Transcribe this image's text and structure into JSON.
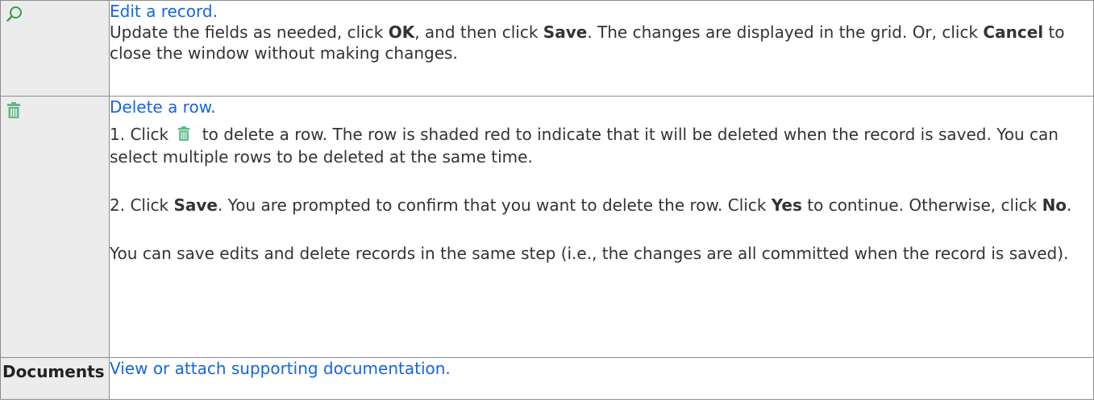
{
  "rows": [
    {
      "icon": "magnifier-icon",
      "link": "Edit a record.",
      "text": [
        "Update the fields as needed, click ",
        "OK",
        ", and then click ",
        "Save",
        ". The changes are displayed in the grid. Or, click ",
        "Cancel",
        " to close the window without making changes."
      ]
    },
    {
      "icon": "trash-icon",
      "link": "Delete a row.",
      "step1": [
        "1. Click ",
        " to delete a row. The row is shaded red to indicate that it will be deleted when the record is saved. You can select multiple rows to be deleted at the same time."
      ],
      "step2": [
        "2. Click ",
        "Save",
        ". You are prompted to confirm that you want to delete the row. Click ",
        "Yes",
        " to continue. Otherwise, click ",
        "No",
        "."
      ],
      "note": "You can save edits and delete records in the same step (i.e., the changes are all committed when the record is saved)."
    },
    {
      "label": "Documents",
      "link": "View or attach supporting documentation."
    }
  ],
  "colors": {
    "link": "#1565e0",
    "icon_green": "#5fb88a",
    "label_bg": "#ececec",
    "border": "#8c8c8c"
  }
}
